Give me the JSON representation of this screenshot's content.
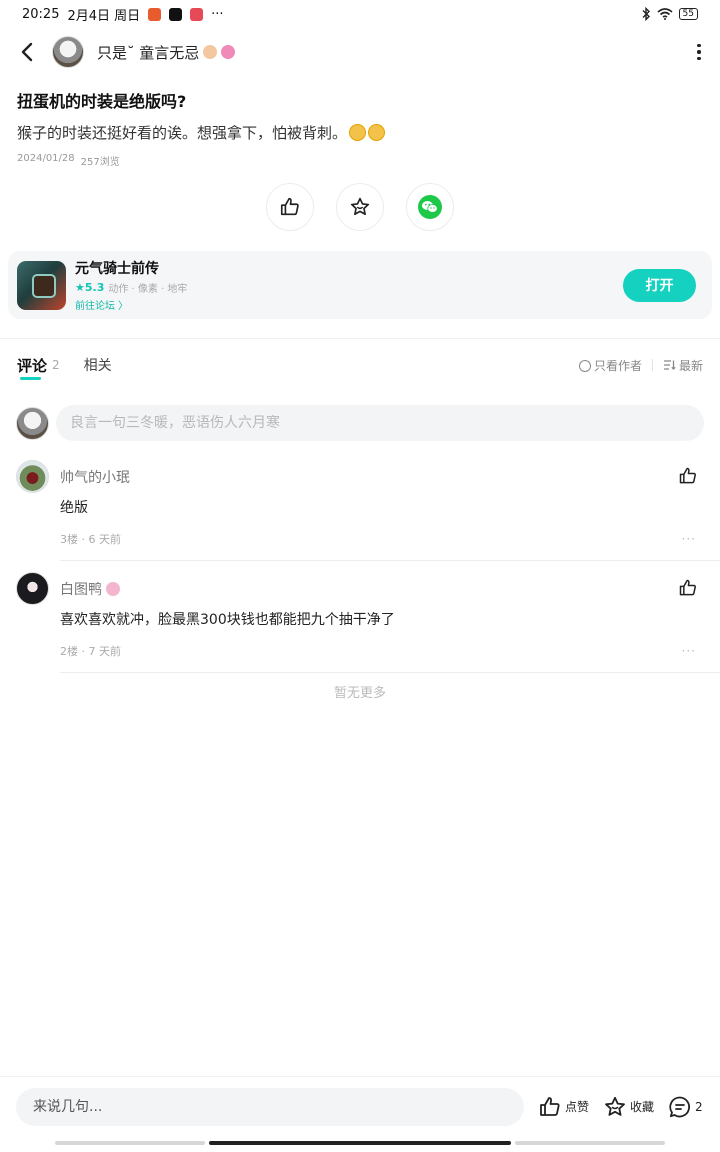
{
  "status_bar": {
    "time": "20:25",
    "date": "2月4日 周日",
    "more": "···",
    "battery": "55"
  },
  "header": {
    "author_name": "只是˘ 童言无忌"
  },
  "post": {
    "title": "扭蛋机的时装是绝版吗?",
    "body": "猴子的时装还挺好看的诶。想强拿下，怕被背刺。",
    "date": "2024/01/28",
    "views": "257浏览"
  },
  "game_card": {
    "name": "元气骑士前传",
    "rating": "★5.3",
    "tags": "动作 · 像素 · 地牢",
    "forum_link": "前往论坛 〉",
    "open_label": "打开"
  },
  "tabs": {
    "comments_label": "评论",
    "comments_count": "2",
    "related_label": "相关",
    "author_only": "只看作者",
    "sort": "最新"
  },
  "comment_input": {
    "placeholder": "良言一句三冬暖，恶语伤人六月寒"
  },
  "comments": [
    {
      "name": "帅气的小珉",
      "text": "绝版",
      "meta": "3楼 · 6 天前",
      "more": "···"
    },
    {
      "name": "白图鸭",
      "text": "喜欢喜欢就冲，脸最黑300块钱也都能把九个抽干净了",
      "meta": "2楼 · 7 天前",
      "more": "···"
    }
  ],
  "no_more": "暂无更多",
  "bottom_bar": {
    "placeholder": "来说几句...",
    "like_label": "点赞",
    "collect_label": "收藏",
    "comment_count": "2"
  },
  "colors": {
    "accent": "#15d1bf",
    "wechat": "#1ec94a"
  },
  "icons": [
    "back-arrow-icon",
    "more-vertical-icon",
    "thumbs-up-icon",
    "star-icon",
    "wechat-icon",
    "radio-icon",
    "sort-icon",
    "comment-icon"
  ]
}
